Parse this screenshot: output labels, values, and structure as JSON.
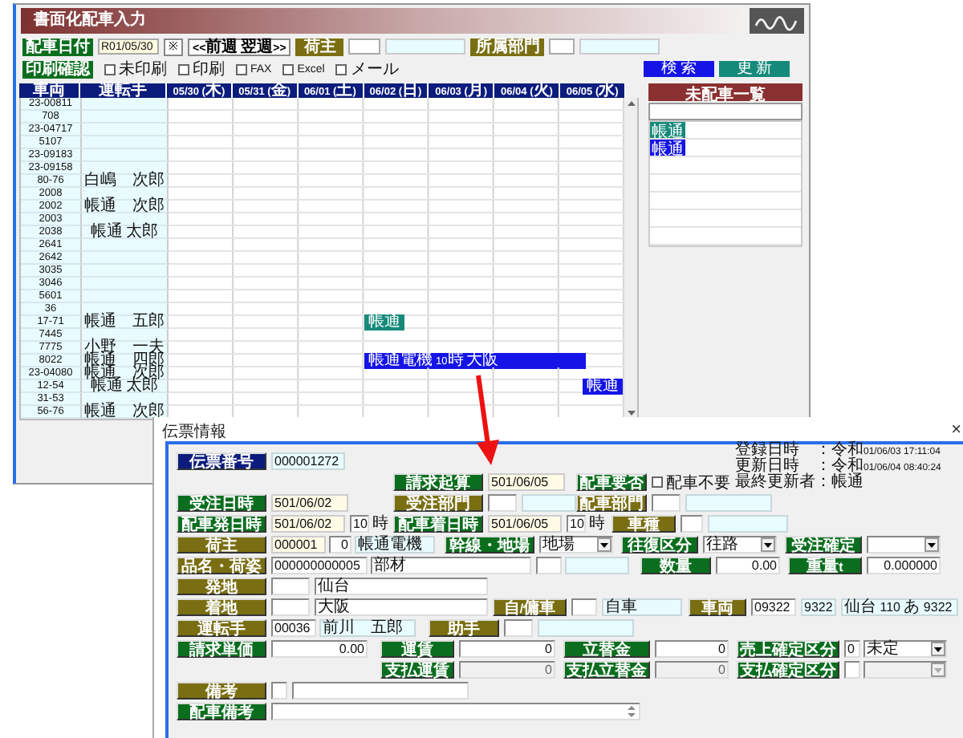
{
  "background_window": {
    "title": "書面化配車入力",
    "date_label": "配車日付",
    "date_value": "R01/05/30",
    "marker": "※",
    "week_button": "<<前週 翌週>>",
    "shipper_label": "荷主",
    "department_label": "所属部門",
    "print_label": "印刷確認",
    "print_options": [
      {
        "label": "未印刷",
        "checked": false
      },
      {
        "label": "印刷",
        "checked": false
      },
      {
        "label": "FAX",
        "checked": false
      },
      {
        "label": "Excel",
        "checked": false
      },
      {
        "label": "メール",
        "checked": false
      }
    ],
    "buttons": [
      {
        "label": "検 索",
        "color": "#1414e6"
      },
      {
        "label": "更 新",
        "color": "#168a7a"
      }
    ],
    "columns": [
      "車両",
      "運転手",
      "05/30 (木)",
      "05/31 (金)",
      "06/01 (土)",
      "06/02 (日)",
      "06/03 (月)",
      "06/04 (火)",
      "06/05 (水)"
    ],
    "rows": [
      {
        "vehicle": "23-00811"
      },
      {
        "vehicle": "708"
      },
      {
        "vehicle": "23-04717"
      },
      {
        "vehicle": "5107"
      },
      {
        "vehicle": "23-09183"
      },
      {
        "vehicle": "23-09158"
      },
      {
        "vehicle": "80-76",
        "driver": "白嶋　次郎"
      },
      {
        "vehicle": "2008"
      },
      {
        "vehicle": "2002",
        "driver": "帳通　次郎"
      },
      {
        "vehicle": "2003"
      },
      {
        "vehicle": "2038",
        "driver": "帳通 太郎"
      },
      {
        "vehicle": "2641"
      },
      {
        "vehicle": "2642"
      },
      {
        "vehicle": "3035"
      },
      {
        "vehicle": "3046"
      },
      {
        "vehicle": "5601"
      },
      {
        "vehicle": "36"
      },
      {
        "vehicle": "17-71",
        "driver": "帳通　五郎",
        "blocks": [
          {
            "label": "帳通",
            "color": "#168a7a"
          }
        ]
      },
      {
        "vehicle": "7445"
      },
      {
        "vehicle": "7775",
        "driver": "小野　一夫"
      },
      {
        "vehicle": "8022",
        "driver": "帳通　四郎",
        "blocks": [
          {
            "label": "帳通電機 10時 大阪",
            "color": "#1414e6"
          }
        ]
      },
      {
        "vehicle": "23-04080",
        "driver": "帳通　次郎"
      },
      {
        "vehicle": "12-54",
        "driver": "帳通 太郎",
        "blocks": [
          {
            "label": "帳通",
            "color": "#1414e6"
          }
        ]
      },
      {
        "vehicle": "31-53"
      },
      {
        "vehicle": "56-76",
        "driver": "帳通　次郎"
      }
    ],
    "unassigned": {
      "header": "未配車一覧",
      "items": [
        {
          "label": "帳通",
          "color": "#168a7a"
        },
        {
          "label": "帳通",
          "color": "#1414e6"
        }
      ]
    }
  },
  "dialog": {
    "title": "伝票情報",
    "close": "×",
    "info": [
      "登録日時　：令和01/06/03 17:11:04",
      "更新日時　：令和01/06/04 08:40:24",
      "最終更新者：帳通"
    ],
    "rows": [
      {
        "groups": [
          {
            "label": "伝票番号",
            "color": "#0c1c7c",
            "fields": [
              {
                "kind": "ref",
                "value": "000001272"
              }
            ]
          }
        ]
      },
      {
        "groups": [
          {
            "label": "請求起算",
            "color": "#0a6e1e",
            "fields": [
              {
                "kind": "date",
                "value": "501/06/05"
              }
            ]
          },
          {
            "label": "配車要否",
            "color": "#0a6e1e",
            "fields": [
              {
                "kind": "check",
                "text": "配車不要",
                "checked": false
              }
            ]
          }
        ]
      },
      {
        "groups": [
          {
            "label": "受注日時",
            "color": "#0a6e1e",
            "fields": [
              {
                "kind": "date",
                "value": "501/06/02"
              }
            ]
          },
          {
            "label": "受注部門",
            "color": "#7a6e12",
            "fields": [
              {
                "kind": "input"
              },
              {
                "kind": "ref"
              }
            ]
          },
          {
            "label": "配車部門",
            "color": "#7a6e12",
            "fields": [
              {
                "kind": "input"
              },
              {
                "kind": "ref"
              }
            ]
          }
        ]
      },
      {
        "groups": [
          {
            "label": "配車発日時",
            "color": "#0a6e1e",
            "fields": [
              {
                "kind": "date",
                "value": "501/06/02"
              },
              {
                "kind": "input",
                "value": "10"
              },
              {
                "kind": "unit",
                "text": "時"
              }
            ]
          },
          {
            "label": "配車着日時",
            "color": "#0a6e1e",
            "fields": [
              {
                "kind": "date",
                "value": "501/06/05"
              },
              {
                "kind": "input",
                "value": "10"
              },
              {
                "kind": "unit",
                "text": "時"
              }
            ]
          },
          {
            "label": "車種",
            "color": "#7a6e12",
            "fields": [
              {
                "kind": "input"
              },
              {
                "kind": "ref"
              }
            ]
          }
        ]
      },
      {
        "groups": [
          {
            "label": "荷主",
            "color": "#7a6e12",
            "fields": [
              {
                "kind": "date",
                "value": "000001"
              },
              {
                "kind": "number",
                "value": "0"
              },
              {
                "kind": "ref",
                "value": "帳通電機"
              }
            ]
          },
          {
            "label": "幹線・地場",
            "color": "#0a6e1e",
            "fields": [
              {
                "kind": "select",
                "value": "地場"
              }
            ]
          },
          {
            "label": "往復区分",
            "color": "#0a6e1e",
            "fields": [
              {
                "kind": "select",
                "value": "往路"
              }
            ]
          },
          {
            "label": "受注確定",
            "color": "#0a6e1e",
            "fields": [
              {
                "kind": "select"
              }
            ]
          }
        ]
      },
      {
        "groups": [
          {
            "label": "品名・荷姿",
            "color": "#7a6e12",
            "fields": [
              {
                "kind": "input",
                "value": "000000000005"
              },
              {
                "kind": "input",
                "value": "部材"
              },
              {
                "kind": "input"
              },
              {
                "kind": "ref"
              }
            ]
          },
          {
            "label": "数量",
            "color": "#0a6e1e",
            "fields": [
              {
                "kind": "number",
                "value": "0.00"
              }
            ]
          },
          {
            "label": "重量t",
            "color": "#0a6e1e",
            "fields": [
              {
                "kind": "number",
                "value": "0.000000"
              }
            ]
          }
        ]
      },
      {
        "groups": [
          {
            "label": "発地",
            "color": "#7a6e12",
            "fields": [
              {
                "kind": "input"
              },
              {
                "kind": "input",
                "value": "仙台"
              }
            ]
          }
        ]
      },
      {
        "groups": [
          {
            "label": "着地",
            "color": "#7a6e12",
            "fields": [
              {
                "kind": "input"
              },
              {
                "kind": "input",
                "value": "大阪"
              }
            ]
          },
          {
            "label": "自/傭車",
            "color": "#7a6e12",
            "fields": [
              {
                "kind": "input"
              },
              {
                "kind": "ref",
                "value": "自車"
              }
            ]
          },
          {
            "label": "車両",
            "color": "#7a6e12",
            "fields": [
              {
                "kind": "input",
                "value": "09322"
              },
              {
                "kind": "ref",
                "value": "9322"
              },
              {
                "kind": "ref",
                "value": "仙台 110 あ 9322"
              }
            ]
          }
        ]
      },
      {
        "groups": [
          {
            "label": "運転手",
            "color": "#7a6e12",
            "fields": [
              {
                "kind": "input",
                "value": "00036"
              },
              {
                "kind": "ref",
                "value": "前川　五郎"
              }
            ]
          },
          {
            "label": "助手",
            "color": "#7a6e12",
            "fields": [
              {
                "kind": "input"
              },
              {
                "kind": "ref"
              }
            ]
          }
        ]
      },
      {
        "groups": [
          {
            "label": "請求単価",
            "color": "#0a6e1e",
            "fields": [
              {
                "kind": "number",
                "value": "0.00"
              }
            ]
          },
          {
            "label": "運賃",
            "color": "#0a6e1e",
            "fields": [
              {
                "kind": "number",
                "value": "0"
              }
            ]
          },
          {
            "label": "立替金",
            "color": "#0a6e1e",
            "fields": [
              {
                "kind": "number",
                "value": "0"
              }
            ]
          },
          {
            "label": "売上確定区分",
            "color": "#0a6e1e",
            "fields": [
              {
                "kind": "input",
                "value": "0"
              },
              {
                "kind": "select",
                "value": "未定"
              }
            ]
          }
        ]
      },
      {
        "groups": [
          {
            "label": "支払運賃",
            "color": "#0a6e1e",
            "fields": [
              {
                "kind": "number-off",
                "value": "0"
              }
            ]
          },
          {
            "label": "支払立替金",
            "color": "#0a6e1e",
            "fields": [
              {
                "kind": "number-off",
                "value": "0"
              }
            ]
          },
          {
            "label": "支払確定区分",
            "color": "#0a6e1e",
            "fields": [
              {
                "kind": "input"
              },
              {
                "kind": "select-off"
              }
            ]
          }
        ]
      },
      {
        "groups": [
          {
            "label": "備考",
            "color": "#7a6e12",
            "fields": [
              {
                "kind": "input"
              },
              {
                "kind": "input"
              }
            ]
          }
        ]
      },
      {
        "groups": [
          {
            "label": "配車備考",
            "color": "#0a6e1e",
            "fields": [
              {
                "kind": "memo"
              }
            ]
          }
        ]
      }
    ]
  }
}
